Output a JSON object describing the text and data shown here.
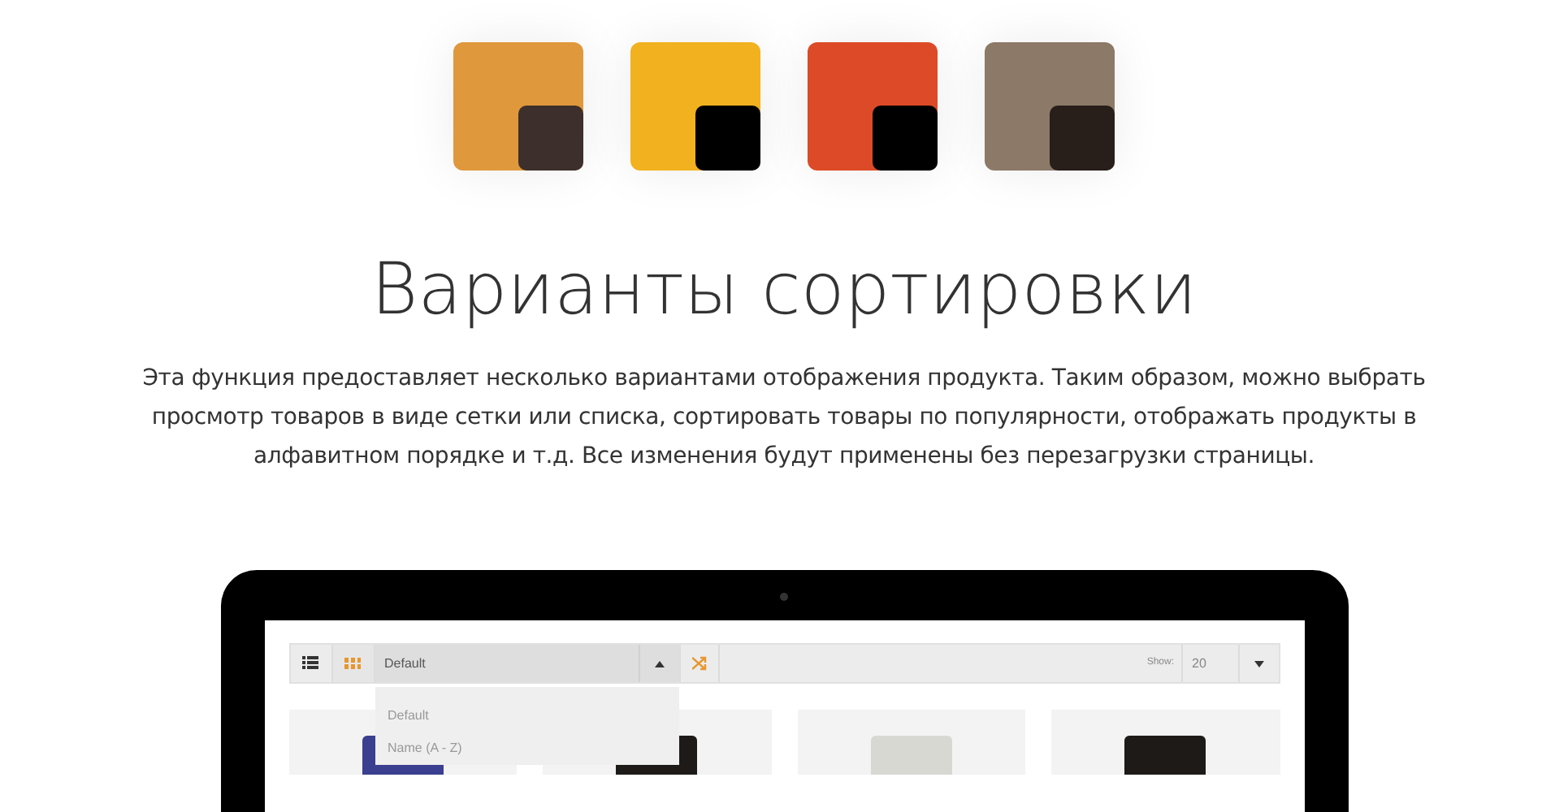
{
  "swatches": [
    {
      "color": "#e0983c",
      "corner": {
        "color": "#3d2f2b"
      }
    },
    {
      "color": "#f2b11f",
      "corner": {
        "color": "#000000"
      }
    },
    {
      "color": "#dd4a27",
      "corner": {
        "color": "#000000"
      }
    },
    {
      "color": "#8c7968",
      "corner": {
        "color": "#281e1a"
      }
    }
  ],
  "title": "Варианты сортировки",
  "description": "Эта функция предоставляет несколько вариантами отображения продукта. Таким образом, можно выбрать просмотр товаров в виде сетки или списка, сортировать товары по популярности, отображать продукты в алфавитном порядке и т.д. Все изменения будут применены без перезагрузки страницы.",
  "toolbar": {
    "views": [
      {
        "kind": "list",
        "selected": false
      },
      {
        "kind": "grid",
        "selected": true
      }
    ],
    "sort": {
      "value": "Default",
      "expanded": true,
      "options": [
        "Default",
        "Name (A - Z)"
      ]
    },
    "show": {
      "label": "Show:",
      "value": "20"
    }
  },
  "products": [
    {
      "kind": "jar"
    },
    {
      "kind": "can"
    },
    {
      "kind": "tin"
    },
    {
      "kind": "can"
    }
  ]
}
